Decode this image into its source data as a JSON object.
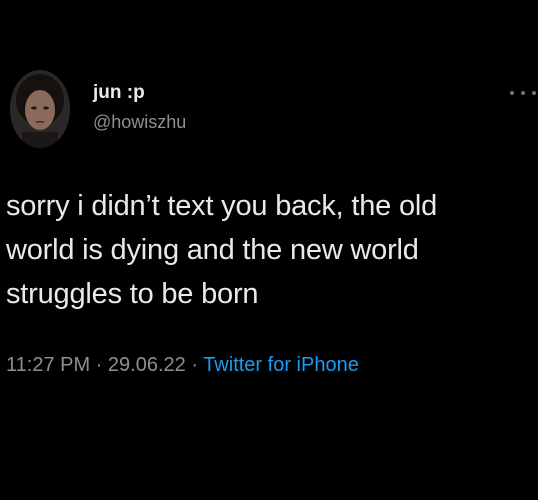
{
  "user": {
    "display_name": "jun :p",
    "handle": "@howiszhu"
  },
  "tweet": {
    "line1": "sorry i didn’t text you back, the old",
    "line2": "world is dying and the new world",
    "line3": "struggles to be born"
  },
  "meta": {
    "time": "11:27 PM",
    "sep1": " · ",
    "date": "29.06.22",
    "sep2": " · ",
    "source": "Twitter for iPhone"
  },
  "icons": {
    "more": "more-options-icon",
    "avatar": "profile-avatar"
  },
  "colors": {
    "background": "#000000",
    "text": "#e7e9ea",
    "secondary": "#8b9096",
    "link": "#1d9bf0"
  }
}
